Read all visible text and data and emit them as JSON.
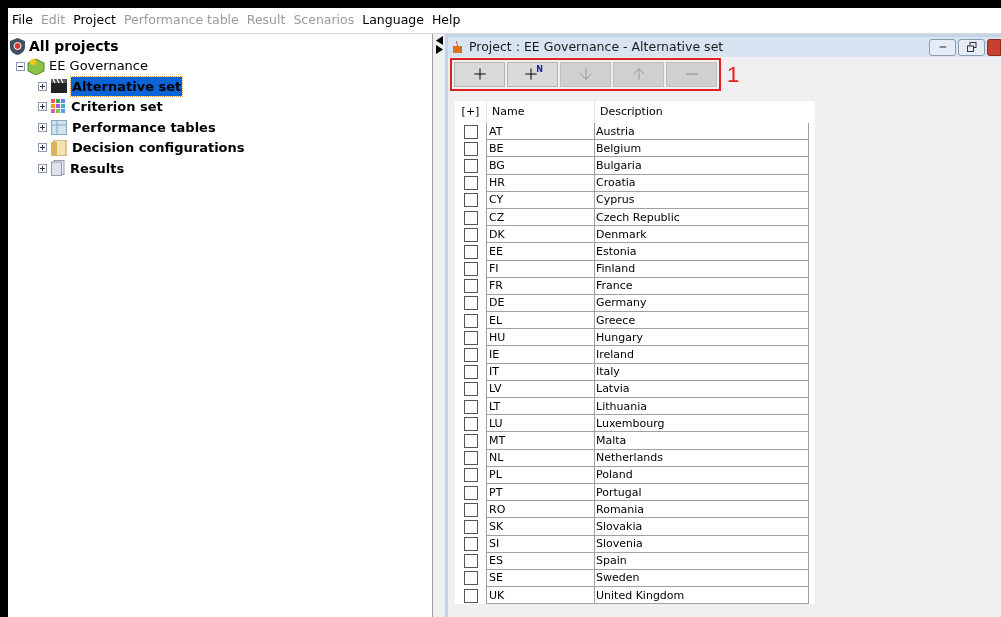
{
  "menu": [
    {
      "label": "File",
      "disabled": false
    },
    {
      "label": "Edit",
      "disabled": true
    },
    {
      "label": "Project",
      "disabled": false
    },
    {
      "label": "Performance table",
      "disabled": true
    },
    {
      "label": "Result",
      "disabled": true
    },
    {
      "label": "Scenarios",
      "disabled": true
    },
    {
      "label": "Language",
      "disabled": false
    },
    {
      "label": "Help",
      "disabled": false
    }
  ],
  "tree": {
    "label": "All projects",
    "children": [
      {
        "label": "EE Governance",
        "expanded": true,
        "children": [
          {
            "label": "Alternative set",
            "kind": "clapper",
            "selected": true,
            "expanded": false
          },
          {
            "label": "Criterion set",
            "kind": "grid",
            "selected": false,
            "expanded": false
          },
          {
            "label": "Performance tables",
            "kind": "table",
            "selected": false,
            "expanded": false
          },
          {
            "label": "Decision configurations",
            "kind": "folder",
            "selected": false,
            "expanded": false
          },
          {
            "label": "Results",
            "kind": "pages",
            "selected": false,
            "expanded": false
          }
        ]
      }
    ]
  },
  "window": {
    "title": "Project : EE Governance - Alternative set"
  },
  "toolbar": [
    {
      "kind": "add",
      "disabled": false
    },
    {
      "kind": "add-n",
      "sup": "N",
      "disabled": false
    },
    {
      "kind": "down",
      "disabled": true
    },
    {
      "kind": "up",
      "disabled": true
    },
    {
      "kind": "remove",
      "disabled": true
    }
  ],
  "annotation": "1",
  "table": {
    "columns": [
      "[+]",
      "Name",
      "Description"
    ],
    "rows": [
      {
        "checked": false,
        "name": "AT",
        "description": "Austria"
      },
      {
        "checked": false,
        "name": "BE",
        "description": "Belgium"
      },
      {
        "checked": false,
        "name": "BG",
        "description": "Bulgaria"
      },
      {
        "checked": false,
        "name": "HR",
        "description": "Croatia"
      },
      {
        "checked": false,
        "name": "CY",
        "description": "Cyprus"
      },
      {
        "checked": false,
        "name": "CZ",
        "description": "Czech Republic"
      },
      {
        "checked": false,
        "name": "DK",
        "description": "Denmark"
      },
      {
        "checked": false,
        "name": "EE",
        "description": "Estonia"
      },
      {
        "checked": false,
        "name": "FI",
        "description": "Finland"
      },
      {
        "checked": false,
        "name": "FR",
        "description": "France"
      },
      {
        "checked": false,
        "name": "DE",
        "description": "Germany"
      },
      {
        "checked": false,
        "name": "EL",
        "description": "Greece"
      },
      {
        "checked": false,
        "name": "HU",
        "description": "Hungary"
      },
      {
        "checked": false,
        "name": "IE",
        "description": "Ireland"
      },
      {
        "checked": false,
        "name": "IT",
        "description": "Italy"
      },
      {
        "checked": false,
        "name": "LV",
        "description": "Latvia"
      },
      {
        "checked": false,
        "name": "LT",
        "description": "Lithuania"
      },
      {
        "checked": false,
        "name": "LU",
        "description": "Luxembourg"
      },
      {
        "checked": false,
        "name": "MT",
        "description": "Malta"
      },
      {
        "checked": false,
        "name": "NL",
        "description": "Netherlands"
      },
      {
        "checked": false,
        "name": "PL",
        "description": "Poland"
      },
      {
        "checked": false,
        "name": "PT",
        "description": "Portugal"
      },
      {
        "checked": false,
        "name": "RO",
        "description": "Romania"
      },
      {
        "checked": false,
        "name": "SK",
        "description": "Slovakia"
      },
      {
        "checked": false,
        "name": "SI",
        "description": "Slovenia"
      },
      {
        "checked": false,
        "name": "ES",
        "description": "Spain"
      },
      {
        "checked": false,
        "name": "SE",
        "description": "Sweden"
      },
      {
        "checked": false,
        "name": "UK",
        "description": "United Kingdom"
      }
    ]
  }
}
